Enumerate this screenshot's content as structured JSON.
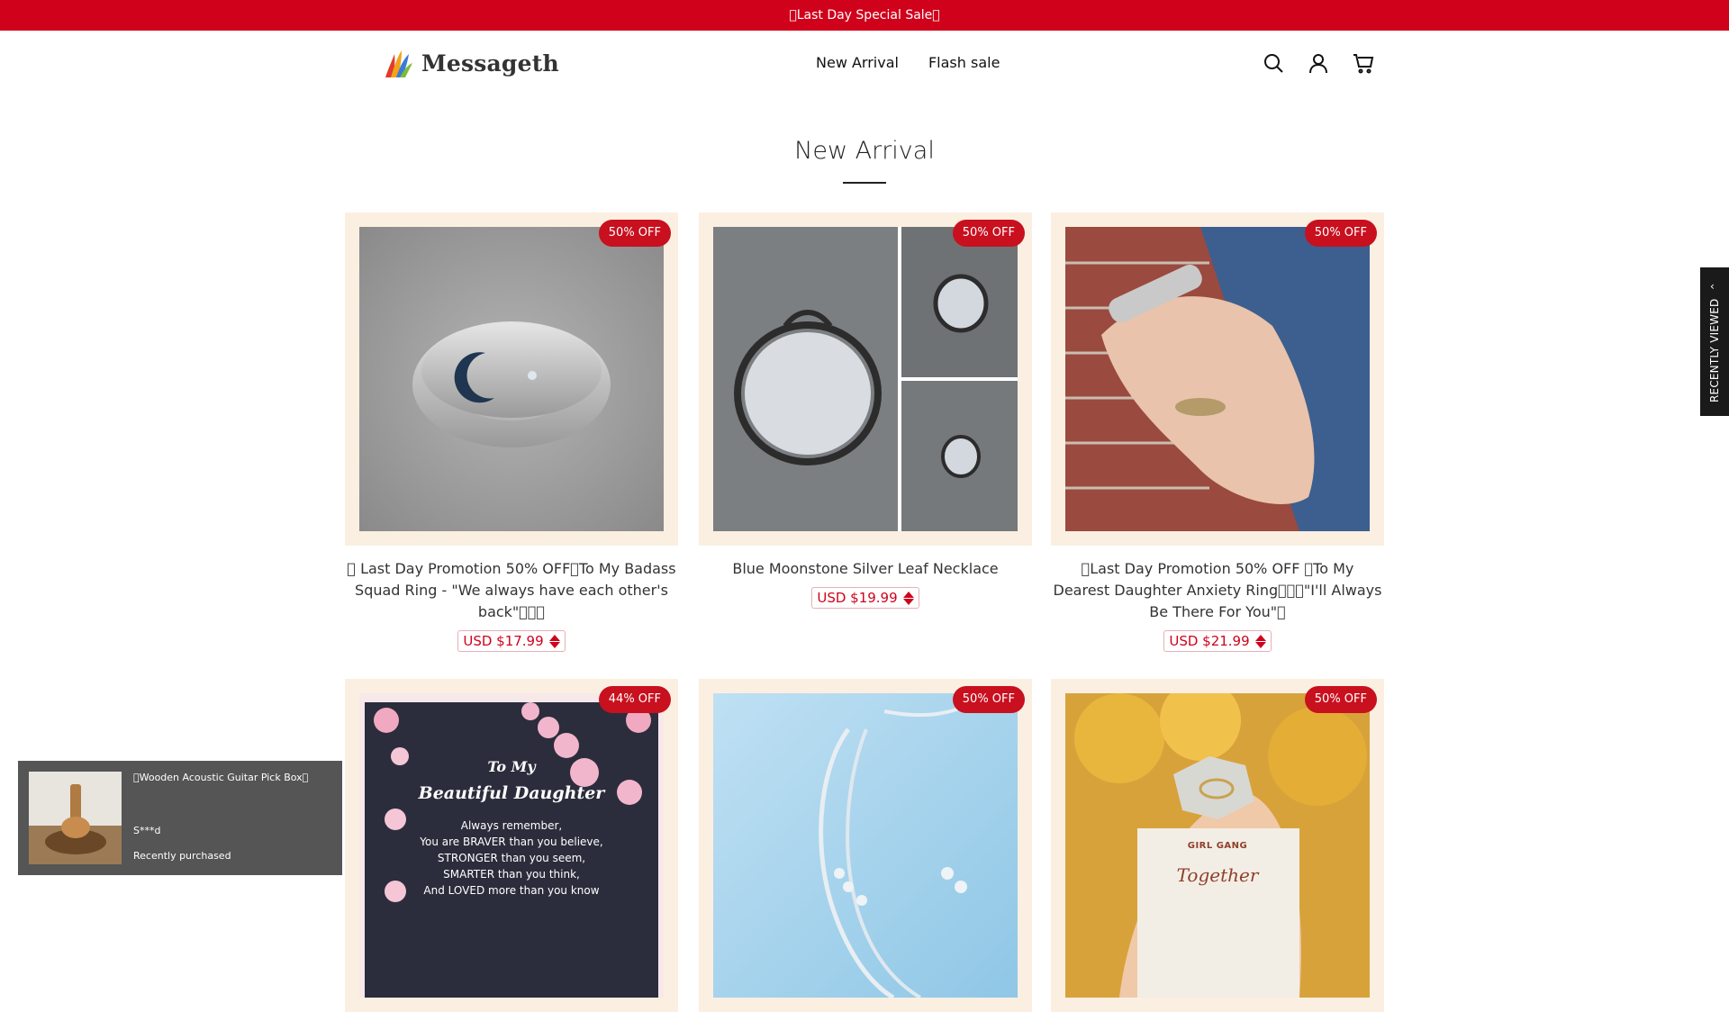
{
  "announcement": "\u0000Last Day Special Sale\u0000",
  "logo": {
    "text": "Messageth"
  },
  "nav": {
    "items": [
      "New Arrival",
      "Flash sale"
    ]
  },
  "header_icons": [
    "search-icon",
    "user-icon",
    "cart-icon"
  ],
  "section": {
    "title": "New Arrival"
  },
  "products": [
    {
      "name": "\u0000 Last Day Promotion 50% OFF\u0000To My Badass Squad Ring - \"We always have each other's back\"\u0000\u0000\u0000",
      "price": "USD $17.99",
      "badge": "50% OFF"
    },
    {
      "name": "Blue Moonstone Silver Leaf Necklace",
      "price": "USD $19.99",
      "badge": "50% OFF"
    },
    {
      "name": "\u0000Last Day Promotion 50% OFF \u0000To My Dearest Daughter Anxiety Ring\u0000\u0000\u0000\"I'll Always Be There For You\"\u0000",
      "price": "USD $21.99",
      "badge": "50% OFF"
    },
    {
      "badge": "44% OFF",
      "image_text": {
        "line1": "To My",
        "line2": "Beautiful Daughter",
        "body": [
          "Always remember,",
          "You are BRAVER than you believe,",
          "STRONGER than you seem,",
          "SMARTER than you think,",
          "And LOVED more than you know"
        ]
      }
    },
    {
      "badge": "50% OFF"
    },
    {
      "badge": "50% OFF",
      "image_text": {
        "line1": "GIRL GANG",
        "line2": "Together"
      }
    }
  ],
  "recently_viewed": {
    "label": "RECENTLY VIEWED"
  },
  "toast": {
    "title": "\u0000Wooden Acoustic Guitar Pick Box\u0000",
    "user": "S***d",
    "status": "Recently purchased"
  },
  "colors": {
    "accent": "#d0021b",
    "card_bg": "#fbefe2",
    "badge": "#c8101e"
  }
}
